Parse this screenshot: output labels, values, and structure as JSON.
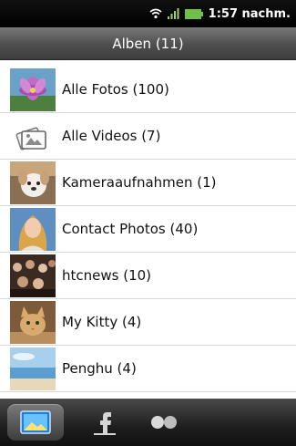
{
  "statusbar": {
    "time": "1:57 nachm.",
    "icons": [
      "wifi-icon",
      "signal-icon",
      "battery-icon"
    ]
  },
  "header": {
    "title": "Alben (11)"
  },
  "albums": [
    {
      "label": "Alle Fotos (100)",
      "thumb": "flower-thumbnail"
    },
    {
      "label": "Alle Videos (7)",
      "thumb": "videos-icon"
    },
    {
      "label": "Kameraaufnahmen (1)",
      "thumb": "dog-thumbnail"
    },
    {
      "label": "Contact Photos (40)",
      "thumb": "portrait-thumbnail"
    },
    {
      "label": "htcnews (10)",
      "thumb": "crowd-thumbnail"
    },
    {
      "label": "My Kitty (4)",
      "thumb": "cat-thumbnail"
    },
    {
      "label": "Penghu (4)",
      "thumb": "beach-thumbnail"
    }
  ],
  "bottom_tabs": [
    {
      "name": "gallery-tab-icon",
      "selected": true
    },
    {
      "name": "facebook-tab-icon",
      "selected": false
    },
    {
      "name": "flickr-tab-icon",
      "selected": false
    }
  ],
  "colors": {
    "status_bar": "#000000",
    "title_bar": "#5a5a5a",
    "list_bg": "#ffffff",
    "divider": "#d9d9d9",
    "bottom_bar": "#1e1e1e"
  }
}
